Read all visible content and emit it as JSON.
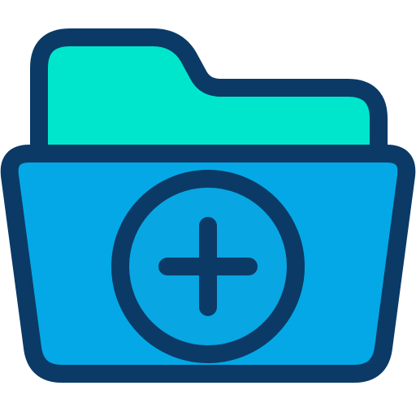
{
  "icon": {
    "name": "add-folder-icon",
    "colors": {
      "outline": "#0b3a66",
      "back_panel": "#00e6cc",
      "front_panel": "#04a8e6",
      "circle": "#08a6e3",
      "background": "#ffffff"
    }
  }
}
